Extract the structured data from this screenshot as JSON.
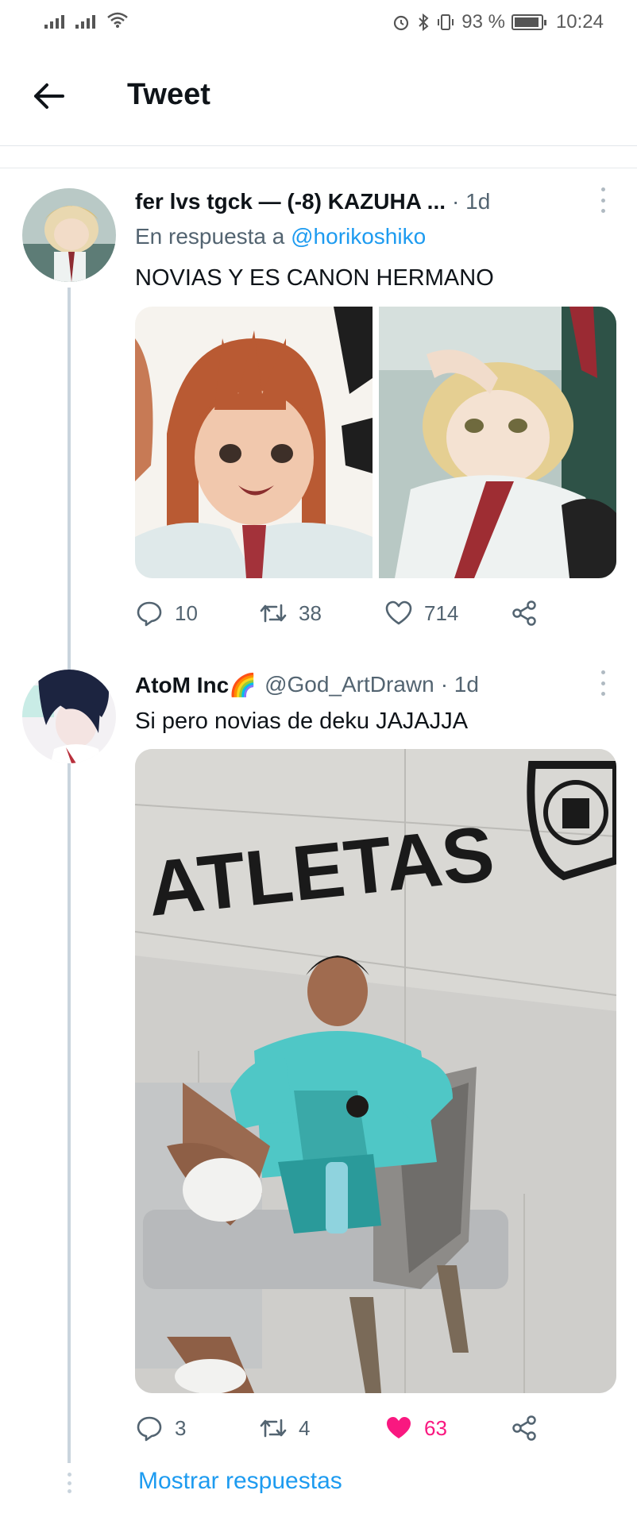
{
  "status_bar": {
    "battery": "93 %",
    "time": "10:24",
    "battery_level": 0.93
  },
  "header": {
    "title": "Tweet"
  },
  "tweets": [
    {
      "name": "fer lvs tgck — (-8) KAZUHA ...",
      "time": "· 1d",
      "reply_prefix": "En respuesta a",
      "reply_mention": "@horikoshiko",
      "text": "NOVIAS Y ES CANON HERMANO",
      "replies": "10",
      "retweets": "38",
      "likes": "714"
    },
    {
      "name": "AtoM Inc🌈",
      "handle": "@God_ArtDrawn",
      "time": "· 1d",
      "text": "Si pero novias de deku JAJAJJA",
      "image_sign": "ATLETAS",
      "replies": "3",
      "retweets": "4",
      "likes": "63"
    }
  ],
  "show_replies": "Mostrar respuestas",
  "colors": {
    "link": "#1d9bf0",
    "like": "#f91880",
    "muted": "#536471",
    "thread": "#c9d4dd"
  },
  "icons": [
    "back-arrow-icon",
    "reply-icon",
    "retweet-icon",
    "like-icon",
    "share-icon",
    "more-icon"
  ]
}
